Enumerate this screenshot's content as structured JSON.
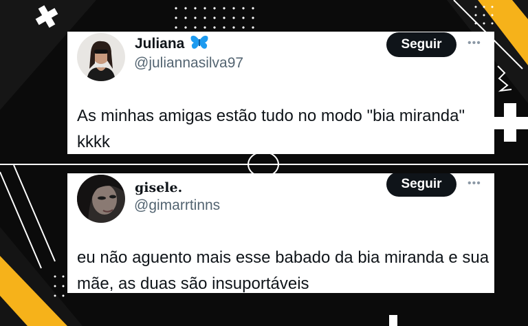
{
  "tweets": [
    {
      "display_name": "Juliana",
      "badge_icon": "butterfly-icon",
      "handle": "@juliannasilva97",
      "follow_label": "Seguir",
      "more_label": "•••",
      "text": "As minhas amigas estão tudo no modo \"bia miranda\" kkkk"
    },
    {
      "display_name": "gisele.",
      "handle": "@gimarrtinns",
      "follow_label": "Seguir",
      "more_label": "•••",
      "text": "eu não aguento mais esse babado da bia miranda e sua mãe, as duas são insuportáveis"
    }
  ],
  "colors": {
    "background": "#0b0b0b",
    "accent_yellow": "#f6b21a",
    "button": "#0f1419",
    "handle": "#536471",
    "butterfly": "#1d9bf0"
  }
}
